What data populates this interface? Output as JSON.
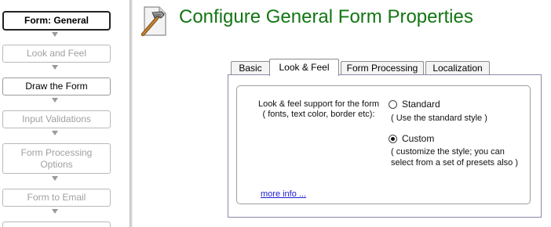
{
  "wizard": {
    "steps": [
      {
        "label": "Form: General",
        "state": "active"
      },
      {
        "label": "Look and Feel",
        "state": "disabled"
      },
      {
        "label": "Draw the Form",
        "state": "enabled"
      },
      {
        "label": "Input Validations",
        "state": "disabled"
      },
      {
        "label": "Form Processing Options",
        "state": "disabled"
      },
      {
        "label": "Form to Email",
        "state": "disabled"
      }
    ]
  },
  "header": {
    "icon": "file-hammer-icon",
    "title": "Configure General Form Properties",
    "title_color": "#127612"
  },
  "tabs": [
    {
      "label": "Basic",
      "selected": false
    },
    {
      "label": "Look & Feel",
      "selected": true
    },
    {
      "label": "Form Processing",
      "selected": false
    },
    {
      "label": "Localization",
      "selected": false
    }
  ],
  "look_feel": {
    "description_line1": "Look & feel support for the form",
    "description_line2": "( fonts, text color, border etc):",
    "options": [
      {
        "label": "Standard",
        "checked": false,
        "note_lines": [
          "( Use the standard style )"
        ]
      },
      {
        "label": "Custom",
        "checked": true,
        "note_lines": [
          "( customize the style; you can",
          "select from a set of presets also )"
        ]
      }
    ],
    "more_info": "more info ...",
    "link_color": "#1b1bd0"
  }
}
